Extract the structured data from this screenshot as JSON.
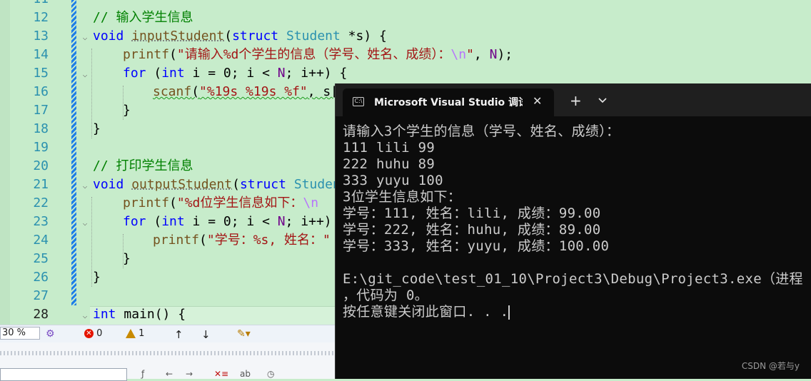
{
  "editor": {
    "line_numbers": [
      "11",
      "12",
      "13",
      "14",
      "15",
      "16",
      "17",
      "18",
      "19",
      "20",
      "21",
      "22",
      "23",
      "24",
      "25",
      "26",
      "27",
      "28"
    ],
    "lines": {
      "l12": "// 输入学生信息",
      "l13_kw": "void",
      "l13_fn": "inputStudent",
      "l13_p1": "(",
      "l13_kw2": "struct",
      "l13_ty": "Student",
      "l13_rest": " *s) {",
      "l14_fn": "printf",
      "l14_o": "(",
      "l14_s1": "\"请输入%d个学生的信息（学号、姓名、成绩）：",
      "l14_esc": "\\n",
      "l14_s2": "\"",
      "l14_c": ", ",
      "l14_ma": "N",
      "l14_e": ");",
      "l15_kw": "for",
      "l15_a": " (",
      "l15_kw2": "int",
      "l15_b": " i = 0; i < ",
      "l15_ma": "N",
      "l15_c": "; i++) {",
      "l16_fn": "scanf",
      "l16_a": "(",
      "l16_s": "\"%19s %19s %f\"",
      "l16_b": ", s[",
      "l17": "}",
      "l18": "}",
      "l20": "// 打印学生信息",
      "l21_kw": "void",
      "l21_fn": "outputStudent",
      "l21_p1": "(",
      "l21_kw2": "struct",
      "l21_ty": "Studen",
      "l22_fn": "printf",
      "l22_a": "(",
      "l22_s": "\"%d位学生信息如下：",
      "l22_esc": "\\n",
      "l23_kw": "for",
      "l23_a": " (",
      "l23_kw2": "int",
      "l23_b": " i = 0; i < ",
      "l23_ma": "N",
      "l23_c": "; i++)",
      "l24_fn": "printf",
      "l24_a": "(",
      "l24_s": "\"学号：%s, 姓名：\"",
      "l25": "}",
      "l26": "}",
      "l28_kw": "int",
      "l28_b": " main() {"
    }
  },
  "statusbar": {
    "zoom": "30 %",
    "errors": "0",
    "warnings": "1",
    "up_arrow": "↑",
    "down_arrow": "↓"
  },
  "lower_toolbar": {
    "back": "←",
    "forward": "→"
  },
  "terminal": {
    "tab_title": "Microsoft Visual Studio 调试控制台",
    "close": "✕",
    "new_tab": "+",
    "output": [
      "请输入3个学生的信息（学号、姓名、成绩）：",
      "111 lili 99",
      "222 huhu 89",
      "333 yuyu 100",
      "3位学生信息如下：",
      "学号：111, 姓名：lili, 成绩：99.00",
      "学号：222, 姓名：huhu, 成绩：89.00",
      "学号：333, 姓名：yuyu, 成绩：100.00",
      "",
      "E:\\git_code\\test_01_10\\Project3\\Debug\\Project3.exe（进程",
      "，代码为 0。",
      "按任意键关闭此窗口. . ."
    ]
  },
  "watermark": "CSDN @若与y",
  "colors": {
    "editor_bg": "#c7eccb",
    "keyword": "#0000ff",
    "type": "#2b91af",
    "comment": "#008000",
    "string": "#a31515",
    "terminal_bg": "#0c0c0c"
  }
}
